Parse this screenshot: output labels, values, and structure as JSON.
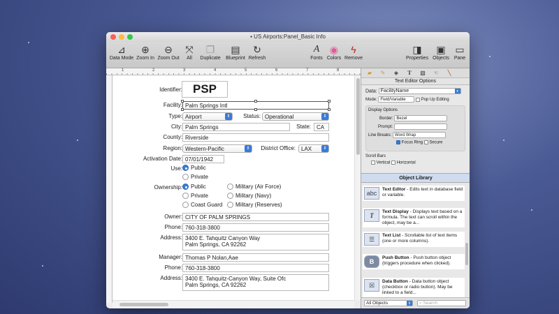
{
  "window": {
    "title": "US Airports:Panel_Basic Info",
    "title_icon": "document-icon"
  },
  "toolbar": {
    "items": [
      {
        "label": "Data Mode",
        "icon": "data-mode-icon",
        "glyph": "⊿"
      },
      {
        "label": "Zoom In",
        "icon": "zoom-in-icon",
        "glyph": "⊕"
      },
      {
        "label": "Zoom Out",
        "icon": "zoom-out-icon",
        "glyph": "⊖"
      },
      {
        "label": "All",
        "icon": "expand-all-icon",
        "glyph": "⤧"
      },
      {
        "label": "Duplicate",
        "icon": "duplicate-icon",
        "glyph": "❐"
      },
      {
        "label": "Blueprint",
        "icon": "blueprint-icon",
        "glyph": "▤"
      },
      {
        "label": "Refresh",
        "icon": "refresh-icon",
        "glyph": "↻"
      },
      {
        "label": "Fonts",
        "icon": "fonts-icon",
        "glyph": "A"
      },
      {
        "label": "Colors",
        "icon": "colors-icon",
        "glyph": "◉"
      },
      {
        "label": "Remove",
        "icon": "remove-icon",
        "glyph": "ϟ"
      },
      {
        "label": "Properties",
        "icon": "properties-icon",
        "glyph": "◨"
      },
      {
        "label": "Objects",
        "icon": "objects-icon",
        "glyph": "▣"
      },
      {
        "label": "Pane",
        "icon": "pane-icon",
        "glyph": "▭"
      }
    ]
  },
  "ruler": {
    "marks": [
      "1",
      "2",
      "3",
      "4",
      "5",
      "6",
      "7",
      "8"
    ]
  },
  "form": {
    "identifier_label": "Identifier:",
    "identifier_value": "PSP",
    "facility_label": "Facility:",
    "facility_value": "Palm Springs Intl",
    "type_label": "Type:",
    "type_value": "Airport",
    "status_label": "Status:",
    "status_value": "Operational",
    "city_label": "City:",
    "city_value": "Palm Springs",
    "state_label": "State:",
    "state_value": "CA",
    "county_label": "County:",
    "county_value": "Riverside",
    "region_label": "Region:",
    "region_value": "Western-Pacific",
    "district_label": "District Office:",
    "district_value": "LAX",
    "activation_label": "Activation Date:",
    "activation_value": "07/01/1942",
    "use_label": "Use:",
    "use_options": [
      "Public",
      "Private"
    ],
    "ownership_label": "Ownership:",
    "ownership_options": [
      "Public",
      "Private",
      "Coast Guard",
      "Military (Air Force)",
      "Military (Navy)",
      "Military (Reserves)"
    ],
    "owner_label": "Owner:",
    "owner_value": "CITY OF PALM SPRINGS",
    "owner_phone_label": "Phone:",
    "owner_phone_value": "760-318-3800",
    "owner_address_label": "Address:",
    "owner_address_line1": "3400 E. Tahquitz Canyon Way",
    "owner_address_line2": "Palm Springs, CA 92262",
    "manager_label": "Manager:",
    "manager_value": "Thomas P Nolan,Aae",
    "manager_phone_label": "Phone:",
    "manager_phone_value": "760-318-3800",
    "manager_address_label": "Address:",
    "manager_address_line1": "3400 E. Tahquitz-Canyon Way, Suite Ofc",
    "manager_address_line2": "Palm Springs, CA 92262"
  },
  "panel": {
    "header": "Text Editor Options",
    "data_label": "Data:",
    "data_value": "FacilityName",
    "mode_label": "Mode:",
    "mode_value": "Field/Variable",
    "popup_editing": "Pop Up Editing",
    "display_options": "Display Options",
    "border_label": "Border:",
    "border_value": "Bezel",
    "prompt_label": "Prompt:",
    "line_breaks_label": "Line Breaks:",
    "line_breaks_value": "Word Wrap",
    "focus_ring": "Focus Ring",
    "secure": "Secure",
    "scroll_bars": "Scroll Bars",
    "vertical": "Vertical",
    "horizontal": "Horizontal"
  },
  "library": {
    "title": "Object Library",
    "items": [
      {
        "name": "Text Editor",
        "desc": " - Edits text in database field or variable.",
        "glyph": "abc",
        "icon": "text-editor-icon"
      },
      {
        "name": "Text Display",
        "desc": " - Displays text based on a formula. The text can scroll within the object, may be a...",
        "glyph": "T",
        "icon": "text-display-icon"
      },
      {
        "name": "Text List",
        "desc": " - Scrollable list of text items (one or more columns).",
        "glyph": "☰",
        "icon": "text-list-icon"
      },
      {
        "name": "Push Button",
        "desc": " - Push button object (triggers procedure when clicked).",
        "glyph": "B",
        "icon": "push-button-icon"
      },
      {
        "name": "Data Button",
        "desc": " - Data button object (checkbox or radio button). May be linked to a field...",
        "glyph": "☒",
        "icon": "data-button-icon"
      }
    ],
    "filter_value": "All Objects",
    "search_placeholder": "Search"
  },
  "colors": {
    "accent": "#3a7bd5",
    "close": "#fc605c",
    "minimize": "#fdbc40",
    "zoom": "#34c84a"
  }
}
